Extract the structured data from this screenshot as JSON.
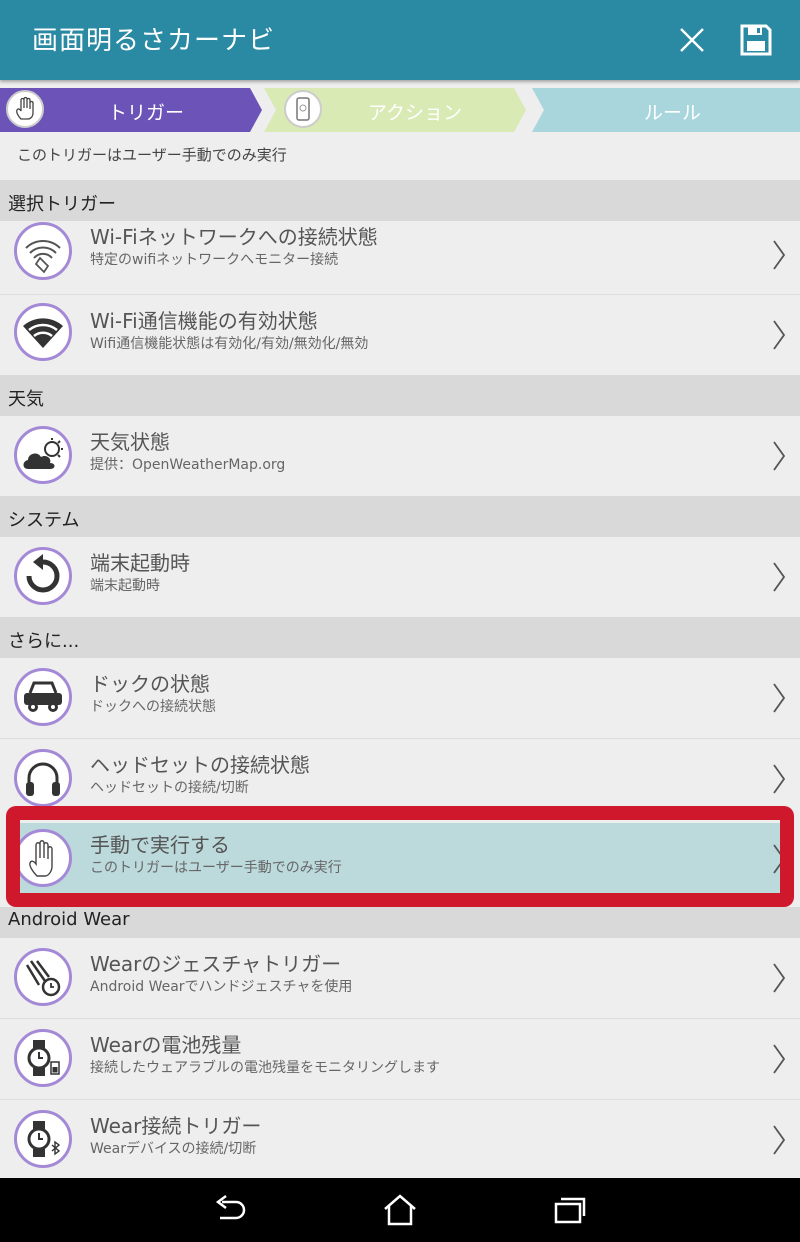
{
  "appbar": {
    "title": "画面明るさカーナビ",
    "close_icon": "close-icon",
    "save_icon": "save-icon"
  },
  "steps": [
    {
      "label": "トリガー",
      "icon": "hand-icon",
      "color": "#6b53b8",
      "state": "active"
    },
    {
      "label": "アクション",
      "icon": "phone-icon",
      "color": "#d9eab4",
      "state": "inactive"
    },
    {
      "label": "ルール",
      "color": "#a9d6dd",
      "state": "inactive"
    }
  ],
  "subtitle": "このトリガーはユーザー手動でのみ実行",
  "sections": [
    {
      "label": "選択トリガー",
      "items": [
        {
          "title": "Wi-Fiネットワークへの接続状態",
          "desc": "特定のwifiネットワークへモニター接続",
          "icon": "wifi-tag-icon"
        },
        {
          "title": "Wi-Fi通信機能の有効状態",
          "desc": "Wifi通信機能状態は有効化/有効/無効化/無効",
          "icon": "wifi-icon"
        }
      ]
    },
    {
      "label": "天気",
      "items": [
        {
          "title": "天気状態",
          "desc": "提供：OpenWeatherMap.org",
          "icon": "weather-icon"
        }
      ]
    },
    {
      "label": "システム",
      "items": [
        {
          "title": "端末起動時",
          "desc": "端末起動時",
          "icon": "restart-icon"
        }
      ]
    },
    {
      "label": "さらに...",
      "items": [
        {
          "title": "ドックの状態",
          "desc": "ドックへの接続状態",
          "icon": "car-icon"
        },
        {
          "title": "ヘッドセットの接続状態",
          "desc": "ヘッドセットの接続/切断",
          "icon": "headset-icon"
        },
        {
          "title": "手動で実行する",
          "desc": "このトリガーはユーザー手動でのみ実行",
          "icon": "hand-icon",
          "highlighted": true
        }
      ]
    },
    {
      "label": "Android Wear",
      "items": [
        {
          "title": "Wearのジェスチャトリガー",
          "desc": "Android Wearでハンドジェスチャを使用",
          "icon": "watch-gesture-icon"
        },
        {
          "title": "Wearの電池残量",
          "desc": "接続したウェアラブルの電池残量をモニタリングします",
          "icon": "watch-battery-icon"
        },
        {
          "title": "Wear接続トリガー",
          "desc": "Wearデバイスの接続/切断",
          "icon": "watch-bluetooth-icon"
        }
      ]
    }
  ],
  "colors": {
    "appbar": "#2b8aa3",
    "accent_purple": "#a48ad6",
    "highlight_frame": "#d0182c",
    "highlight_row": "#bcd9dc"
  },
  "navbar": {
    "back_icon": "back-icon",
    "home_icon": "home-icon",
    "recents_icon": "recents-icon"
  }
}
